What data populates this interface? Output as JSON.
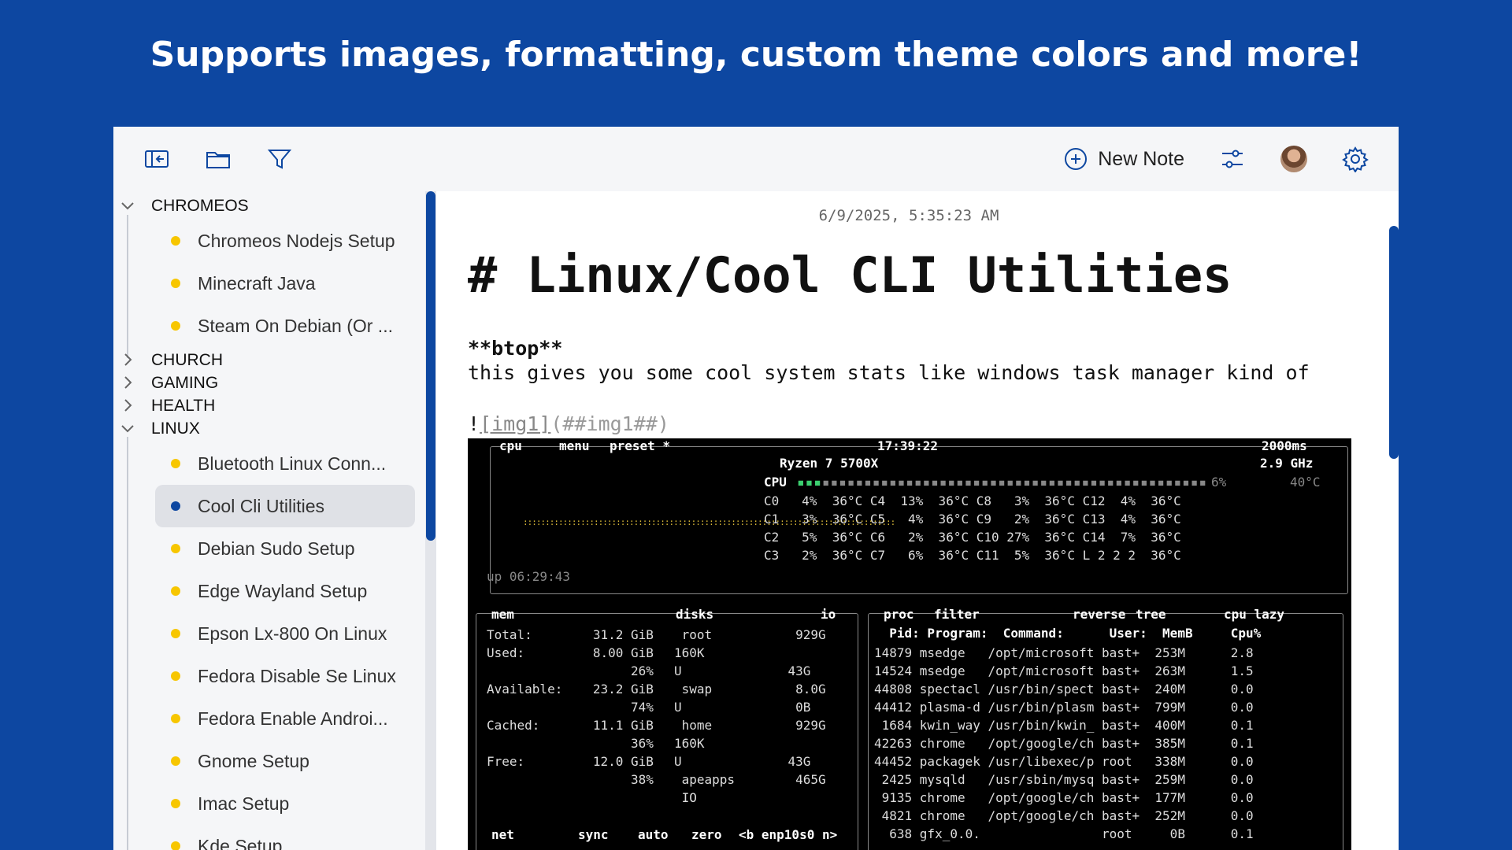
{
  "banner": {
    "text": "Supports images, formatting, custom theme colors and more!"
  },
  "toolbar": {
    "icons": [
      "sidebar-collapse-icon",
      "folder-icon",
      "filter-icon",
      "sliders-icon",
      "gear-icon"
    ],
    "new_note_label": "New Note"
  },
  "sidebar": {
    "folders": [
      {
        "name": "CHROMEOS",
        "expanded": true,
        "notes": [
          "Chromeos Nodejs Setup",
          "Minecraft Java",
          "Steam On Debian (Or ..."
        ]
      },
      {
        "name": "CHURCH",
        "expanded": false
      },
      {
        "name": "GAMING",
        "expanded": false
      },
      {
        "name": "HEALTH",
        "expanded": false
      },
      {
        "name": "LINUX",
        "expanded": true,
        "notes": [
          "Bluetooth Linux Conn...",
          "Cool Cli Utilities",
          "Debian Sudo Setup",
          "Edge Wayland Setup",
          "Epson Lx-800 On Linux",
          "Fedora Disable Se Linux",
          "Fedora Enable Androi...",
          "Gnome Setup",
          "Imac Setup",
          "Kde Setup"
        ]
      }
    ],
    "active_note": "Cool Cli Utilities"
  },
  "note": {
    "timestamp": "6/9/2025, 5:35:23 AM",
    "heading": "# Linux/Cool CLI Utilities",
    "bold_line": "**btop**",
    "text_line": "this gives you some cool system stats like windows task manager kind of",
    "image_ref": {
      "bang": "!",
      "link": "[img1]",
      "target": "(##img1##)"
    }
  },
  "terminal": {
    "top_bar": {
      "cpu": "cpu",
      "menu": "menu",
      "preset": "preset *",
      "time": "17:39:22",
      "interval": "2000ms"
    },
    "cpu_name": "Ryzen 7 5700X",
    "cpu_freq": "2.9 GHz",
    "cpu_total": {
      "label": "CPU",
      "pct": "6%",
      "temp": "40°C"
    },
    "uptime": "up 06:29:43",
    "cores": [
      "C0   4%  36°C C4  13%  36°C C8   3%  36°C C12  4%  36°C",
      "C1   3%  36°C C5   4%  36°C C9   2%  36°C C13  4%  36°C",
      "C2   5%  36°C C6   2%  36°C C10 27%  36°C C14  7%  36°C",
      "C3   2%  36°C C7   6%  36°C C11  5%  36°C L 2 2 2  36°C"
    ],
    "mem": {
      "title": "mem",
      "rows": [
        "Total:        31.2 GiB",
        "Used:         8.00 GiB",
        "                   26%",
        "Available:    23.2 GiB",
        "                   74%",
        "Cached:       11.1 GiB",
        "                   36%",
        "Free:         12.0 GiB",
        "                   38%"
      ]
    },
    "disks": {
      "title": "disks",
      "io": "io",
      "rows": [
        " root           929G",
        "160K",
        "U              43G",
        " swap           8.0G",
        "U               0B",
        " home           929G",
        "160K",
        "U              43G",
        " apeapps        465G",
        " IO"
      ]
    },
    "proc": {
      "title": "proc",
      "filter": "filter",
      "reverse": "reverse",
      "tree": "tree",
      "sort": "cpu lazy",
      "header": "  Pid: Program:  Command:      User:  MemB     Cpu%",
      "rows": [
        "14879 msedge   /opt/microsoft bast+  253M      2.8",
        "14524 msedge   /opt/microsoft bast+  263M      1.5",
        "44808 spectacl /usr/bin/spect bast+  240M      0.0",
        "44412 plasma-d /usr/bin/plasm bast+  799M      0.0",
        " 1684 kwin_way /usr/bin/kwin_ bast+  400M      0.1",
        "42263 chrome   /opt/google/ch bast+  385M      0.1",
        "44452 packagek /usr/libexec/p root   338M      0.0",
        " 2425 mysqld   /usr/sbin/mysq bast+  259M      0.0",
        " 9135 chrome   /opt/google/ch bast+  177M      0.0",
        " 4821 chrome   /opt/google/ch bast+  252M      0.0",
        "  638 gfx_0.0.                root     0B      0.1"
      ]
    },
    "net": {
      "title": "net",
      "sync": "sync",
      "auto": "auto",
      "zero": "zero",
      "iface": "<b enp10s0 n>"
    }
  }
}
